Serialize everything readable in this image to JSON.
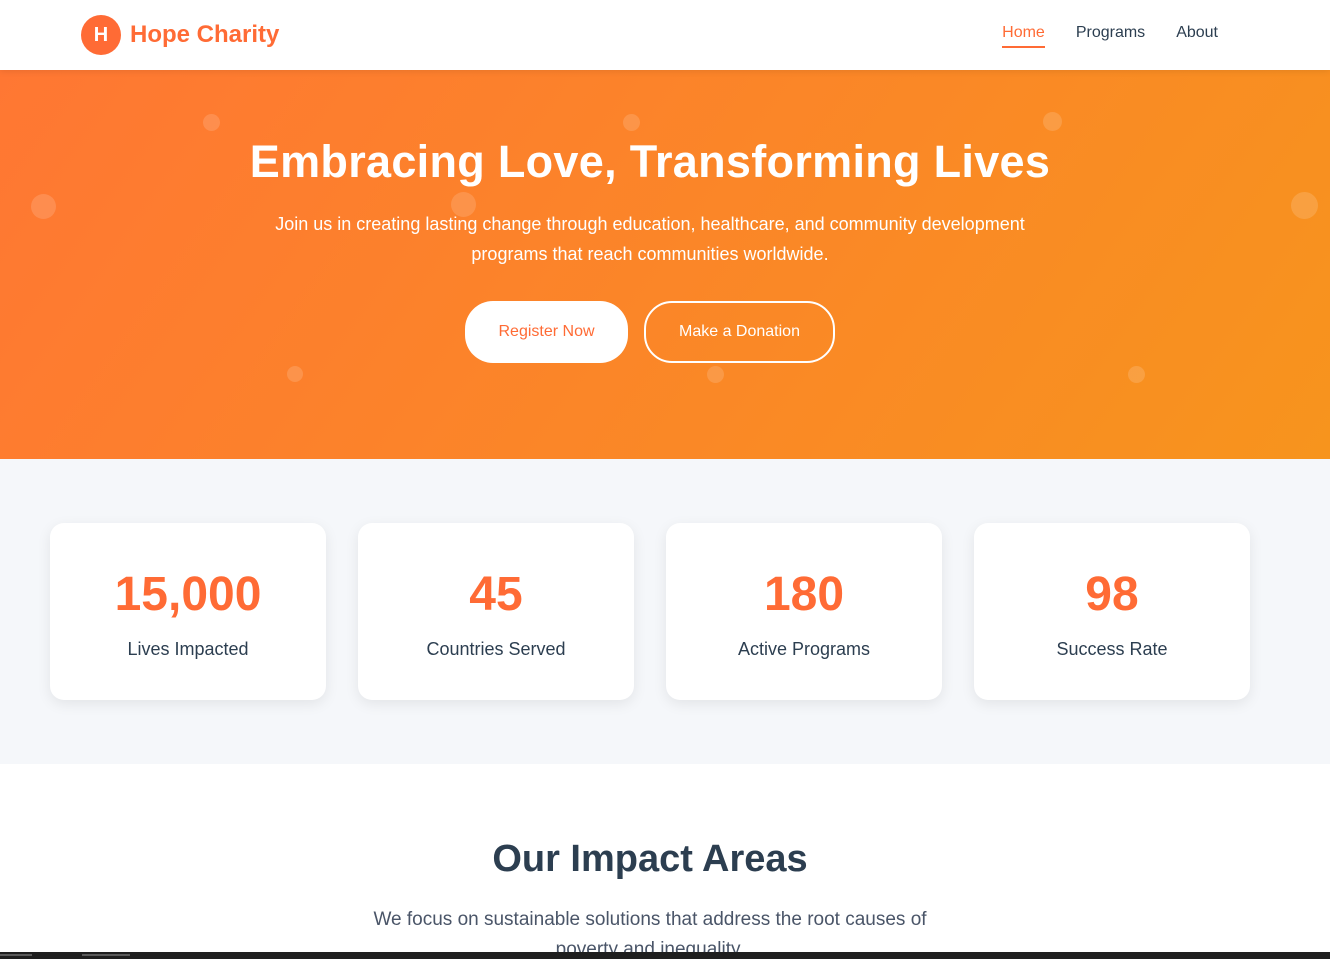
{
  "brand": {
    "mark": "H",
    "name": "Hope Charity",
    "accent": "#ff6b35"
  },
  "nav": {
    "items": [
      {
        "label": "Home",
        "active": true
      },
      {
        "label": "Programs",
        "active": false
      },
      {
        "label": "About",
        "active": false
      }
    ]
  },
  "hero": {
    "title": "Embracing Love, Transforming Lives",
    "subtitle": "Join us in creating lasting change through education, healthcare, and community development programs that reach communities worldwide.",
    "primary_button": "Register Now",
    "secondary_button": "Make a Donation",
    "gradient": [
      "#ff7733",
      "#f7941d"
    ]
  },
  "stats": [
    {
      "value": "15,000",
      "label": "Lives Impacted"
    },
    {
      "value": "45",
      "label": "Countries Served"
    },
    {
      "value": "180",
      "label": "Active Programs"
    },
    {
      "value": "98",
      "label": "Success Rate"
    }
  ],
  "impact": {
    "title": "Our Impact Areas",
    "subtitle": "We focus on sustainable solutions that address the root causes of poverty and inequality."
  }
}
